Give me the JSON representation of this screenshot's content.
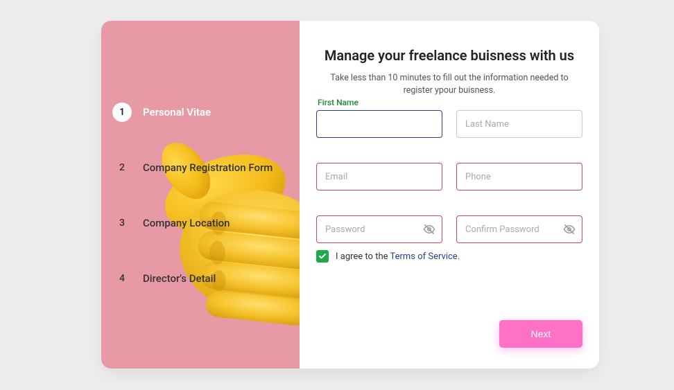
{
  "sidebar": {
    "steps": [
      {
        "num": "1",
        "label": "Personal Vitae"
      },
      {
        "num": "2",
        "label": "Company Registration Form"
      },
      {
        "num": "3",
        "label": "Company Location"
      },
      {
        "num": "4",
        "label": "Director's Detail"
      }
    ]
  },
  "main": {
    "title": "Manage your freelance buisness with us",
    "subtitle": "Take less than 10 minutes to fill out the information needed to register ypour buisness.",
    "first_name_label": "First Name",
    "last_name_placeholder": "Last Name",
    "email_placeholder": "Email",
    "phone_placeholder": "Phone",
    "password_placeholder": "Password",
    "confirm_password_placeholder": "Confirm Password",
    "terms_prefix": "I agree to the ",
    "terms_link": "Terms of Service",
    "terms_suffix": ".",
    "next_label": "Next"
  },
  "colors": {
    "sidebar_bg": "#e79aa5",
    "accent_pink": "#ff70c7",
    "focus_blue": "#2a3b8f",
    "error_red": "#d04a4a",
    "success_green": "#1ea94a",
    "label_green": "#1b8a3a"
  }
}
